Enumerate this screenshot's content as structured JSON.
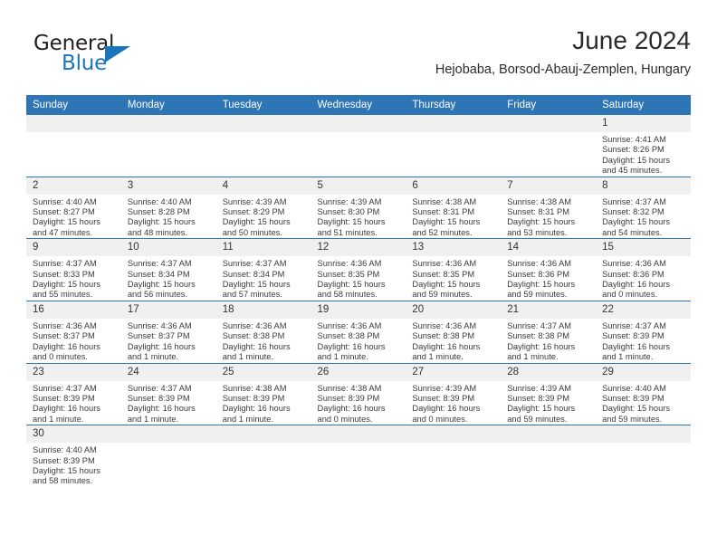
{
  "brand": {
    "name_top": "General",
    "name_bottom": "Blue",
    "triangle_color": "#1b75bb",
    "text_color": "#231f20"
  },
  "header": {
    "title": "June 2024",
    "subtitle": "Hejobaba, Borsod-Abauj-Zemplen, Hungary"
  },
  "theme": {
    "header_row_color": "#2e75b6",
    "day_number_band": "#f0f0f0",
    "grid_line": "#2e75b6",
    "text": "#3b3b3b"
  },
  "calendar": {
    "weekday_headers": [
      "Sunday",
      "Monday",
      "Tuesday",
      "Wednesday",
      "Thursday",
      "Friday",
      "Saturday"
    ],
    "labels": {
      "sunrise": "Sunrise:",
      "sunset": "Sunset:",
      "daylight": "Daylight:"
    },
    "weeks": [
      [
        {
          "day": "",
          "empty": true
        },
        {
          "day": "",
          "empty": true
        },
        {
          "day": "",
          "empty": true
        },
        {
          "day": "",
          "empty": true
        },
        {
          "day": "",
          "empty": true
        },
        {
          "day": "",
          "empty": true
        },
        {
          "day": "1",
          "sunrise": "Sunrise: 4:41 AM",
          "sunset": "Sunset: 8:26 PM",
          "daylight": "Daylight: 15 hours and 45 minutes."
        }
      ],
      [
        {
          "day": "2",
          "sunrise": "Sunrise: 4:40 AM",
          "sunset": "Sunset: 8:27 PM",
          "daylight": "Daylight: 15 hours and 47 minutes."
        },
        {
          "day": "3",
          "sunrise": "Sunrise: 4:40 AM",
          "sunset": "Sunset: 8:28 PM",
          "daylight": "Daylight: 15 hours and 48 minutes."
        },
        {
          "day": "4",
          "sunrise": "Sunrise: 4:39 AM",
          "sunset": "Sunset: 8:29 PM",
          "daylight": "Daylight: 15 hours and 50 minutes."
        },
        {
          "day": "5",
          "sunrise": "Sunrise: 4:39 AM",
          "sunset": "Sunset: 8:30 PM",
          "daylight": "Daylight: 15 hours and 51 minutes."
        },
        {
          "day": "6",
          "sunrise": "Sunrise: 4:38 AM",
          "sunset": "Sunset: 8:31 PM",
          "daylight": "Daylight: 15 hours and 52 minutes."
        },
        {
          "day": "7",
          "sunrise": "Sunrise: 4:38 AM",
          "sunset": "Sunset: 8:31 PM",
          "daylight": "Daylight: 15 hours and 53 minutes."
        },
        {
          "day": "8",
          "sunrise": "Sunrise: 4:37 AM",
          "sunset": "Sunset: 8:32 PM",
          "daylight": "Daylight: 15 hours and 54 minutes."
        }
      ],
      [
        {
          "day": "9",
          "sunrise": "Sunrise: 4:37 AM",
          "sunset": "Sunset: 8:33 PM",
          "daylight": "Daylight: 15 hours and 55 minutes."
        },
        {
          "day": "10",
          "sunrise": "Sunrise: 4:37 AM",
          "sunset": "Sunset: 8:34 PM",
          "daylight": "Daylight: 15 hours and 56 minutes."
        },
        {
          "day": "11",
          "sunrise": "Sunrise: 4:37 AM",
          "sunset": "Sunset: 8:34 PM",
          "daylight": "Daylight: 15 hours and 57 minutes."
        },
        {
          "day": "12",
          "sunrise": "Sunrise: 4:36 AM",
          "sunset": "Sunset: 8:35 PM",
          "daylight": "Daylight: 15 hours and 58 minutes."
        },
        {
          "day": "13",
          "sunrise": "Sunrise: 4:36 AM",
          "sunset": "Sunset: 8:35 PM",
          "daylight": "Daylight: 15 hours and 59 minutes."
        },
        {
          "day": "14",
          "sunrise": "Sunrise: 4:36 AM",
          "sunset": "Sunset: 8:36 PM",
          "daylight": "Daylight: 15 hours and 59 minutes."
        },
        {
          "day": "15",
          "sunrise": "Sunrise: 4:36 AM",
          "sunset": "Sunset: 8:36 PM",
          "daylight": "Daylight: 16 hours and 0 minutes."
        }
      ],
      [
        {
          "day": "16",
          "sunrise": "Sunrise: 4:36 AM",
          "sunset": "Sunset: 8:37 PM",
          "daylight": "Daylight: 16 hours and 0 minutes."
        },
        {
          "day": "17",
          "sunrise": "Sunrise: 4:36 AM",
          "sunset": "Sunset: 8:37 PM",
          "daylight": "Daylight: 16 hours and 1 minute."
        },
        {
          "day": "18",
          "sunrise": "Sunrise: 4:36 AM",
          "sunset": "Sunset: 8:38 PM",
          "daylight": "Daylight: 16 hours and 1 minute."
        },
        {
          "day": "19",
          "sunrise": "Sunrise: 4:36 AM",
          "sunset": "Sunset: 8:38 PM",
          "daylight": "Daylight: 16 hours and 1 minute."
        },
        {
          "day": "20",
          "sunrise": "Sunrise: 4:36 AM",
          "sunset": "Sunset: 8:38 PM",
          "daylight": "Daylight: 16 hours and 1 minute."
        },
        {
          "day": "21",
          "sunrise": "Sunrise: 4:37 AM",
          "sunset": "Sunset: 8:38 PM",
          "daylight": "Daylight: 16 hours and 1 minute."
        },
        {
          "day": "22",
          "sunrise": "Sunrise: 4:37 AM",
          "sunset": "Sunset: 8:39 PM",
          "daylight": "Daylight: 16 hours and 1 minute."
        }
      ],
      [
        {
          "day": "23",
          "sunrise": "Sunrise: 4:37 AM",
          "sunset": "Sunset: 8:39 PM",
          "daylight": "Daylight: 16 hours and 1 minute."
        },
        {
          "day": "24",
          "sunrise": "Sunrise: 4:37 AM",
          "sunset": "Sunset: 8:39 PM",
          "daylight": "Daylight: 16 hours and 1 minute."
        },
        {
          "day": "25",
          "sunrise": "Sunrise: 4:38 AM",
          "sunset": "Sunset: 8:39 PM",
          "daylight": "Daylight: 16 hours and 1 minute."
        },
        {
          "day": "26",
          "sunrise": "Sunrise: 4:38 AM",
          "sunset": "Sunset: 8:39 PM",
          "daylight": "Daylight: 16 hours and 0 minutes."
        },
        {
          "day": "27",
          "sunrise": "Sunrise: 4:39 AM",
          "sunset": "Sunset: 8:39 PM",
          "daylight": "Daylight: 16 hours and 0 minutes."
        },
        {
          "day": "28",
          "sunrise": "Sunrise: 4:39 AM",
          "sunset": "Sunset: 8:39 PM",
          "daylight": "Daylight: 15 hours and 59 minutes."
        },
        {
          "day": "29",
          "sunrise": "Sunrise: 4:40 AM",
          "sunset": "Sunset: 8:39 PM",
          "daylight": "Daylight: 15 hours and 59 minutes."
        }
      ],
      [
        {
          "day": "30",
          "sunrise": "Sunrise: 4:40 AM",
          "sunset": "Sunset: 8:39 PM",
          "daylight": "Daylight: 15 hours and 58 minutes."
        },
        {
          "day": "",
          "empty": true
        },
        {
          "day": "",
          "empty": true
        },
        {
          "day": "",
          "empty": true
        },
        {
          "day": "",
          "empty": true
        },
        {
          "day": "",
          "empty": true
        },
        {
          "day": "",
          "empty": true
        }
      ]
    ]
  }
}
